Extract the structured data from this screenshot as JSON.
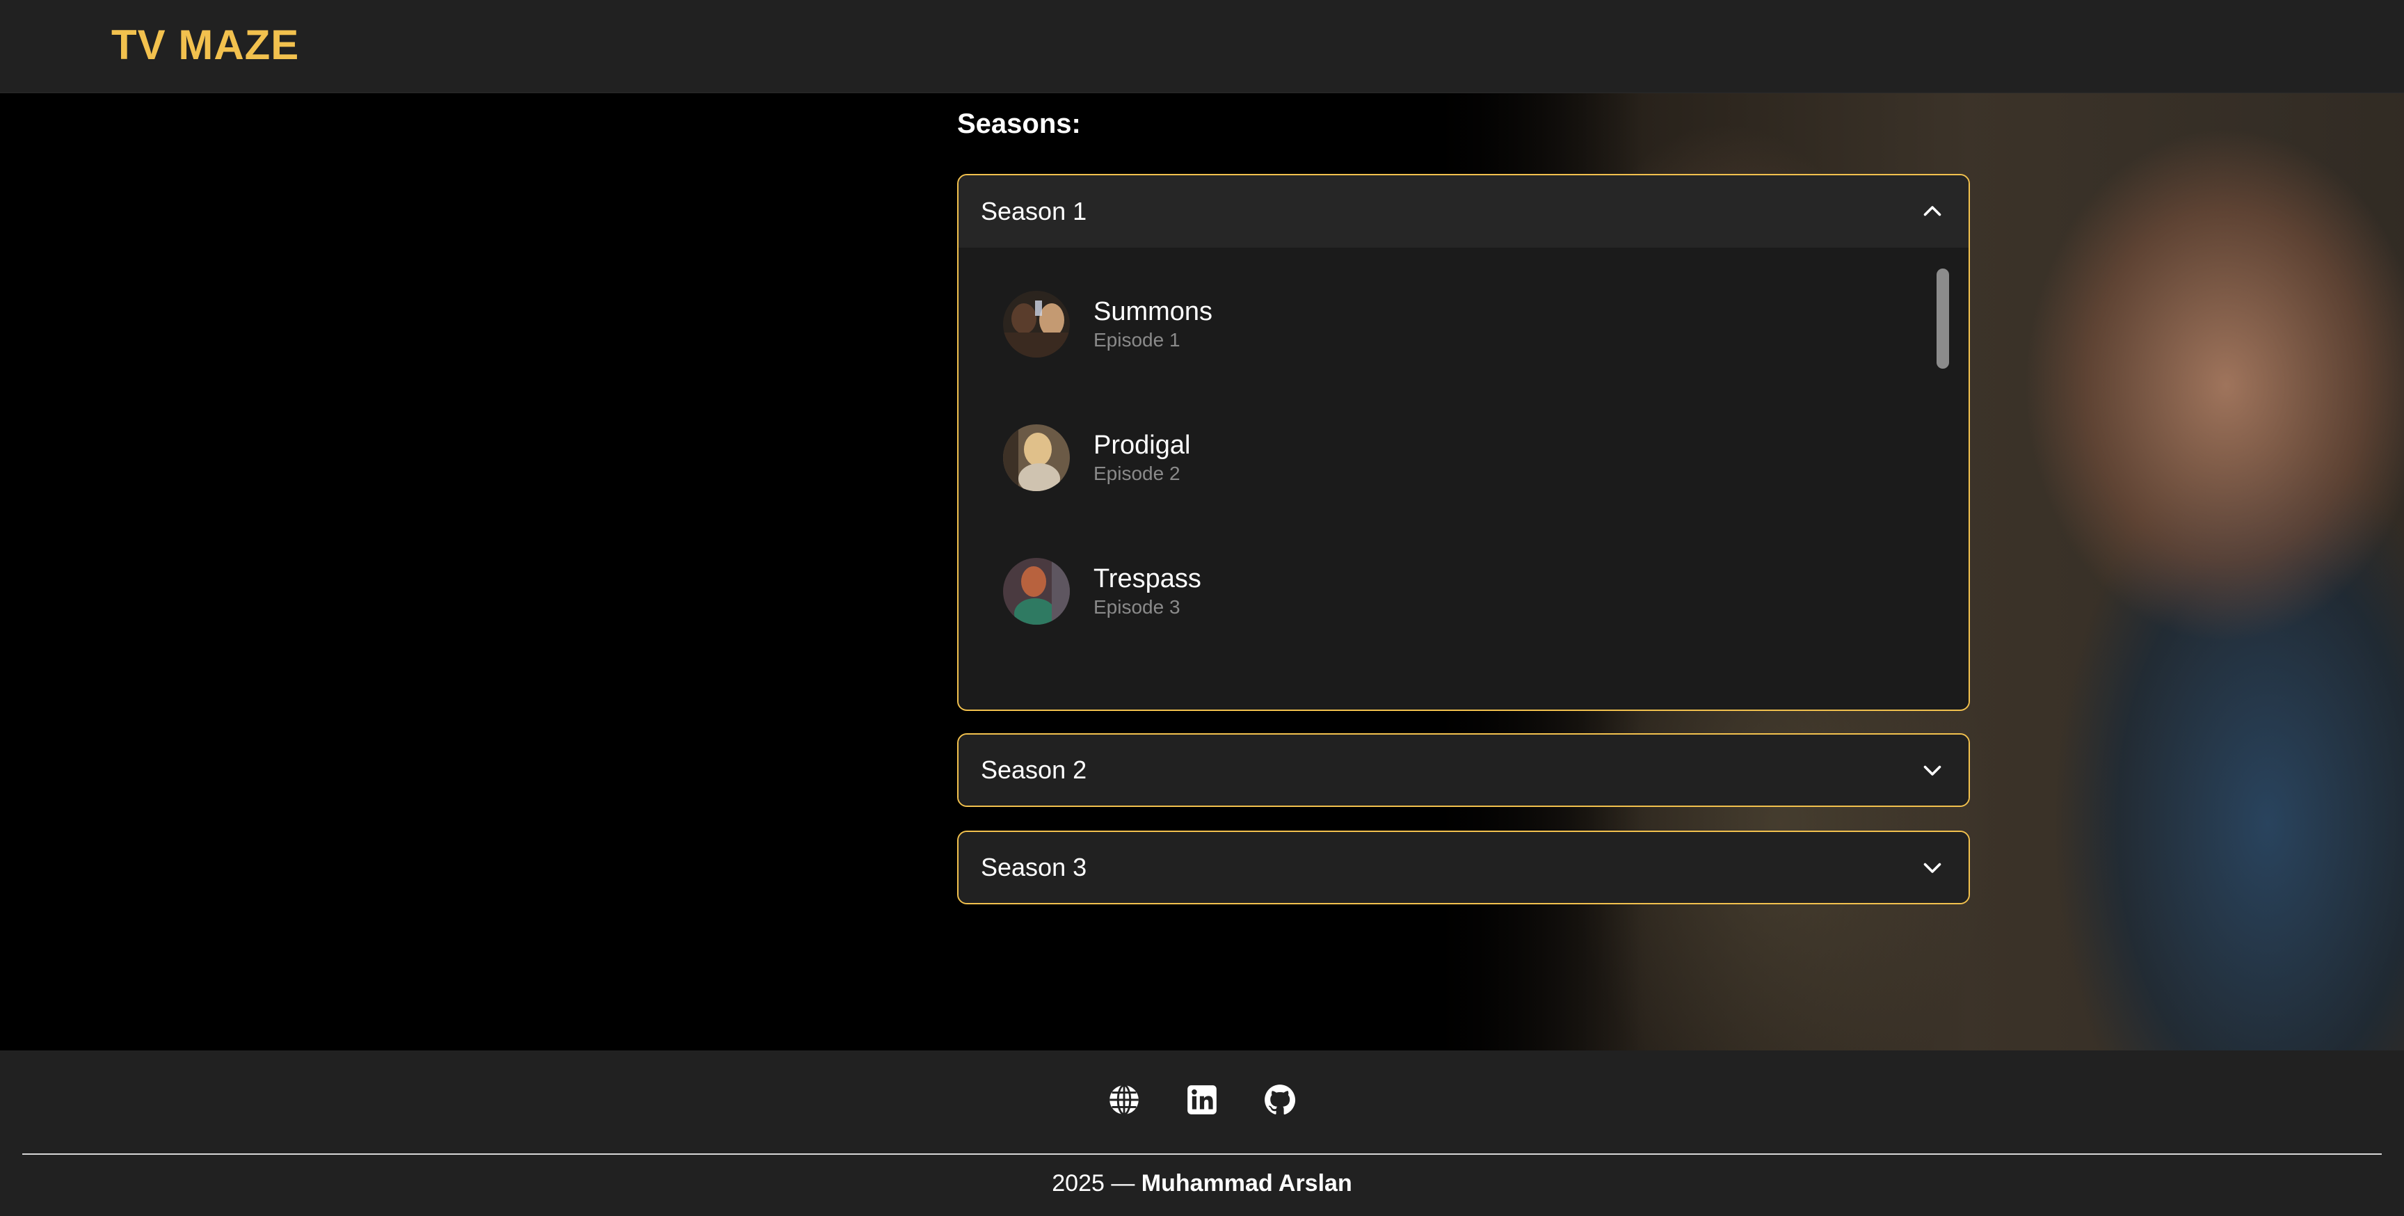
{
  "app": {
    "brand": "TV MAZE"
  },
  "seasons": {
    "title": "Seasons:",
    "list": [
      {
        "label": "Season 1",
        "expanded": true,
        "episodes": [
          {
            "name": "Summons",
            "number": "Episode 1"
          },
          {
            "name": "Prodigal",
            "number": "Episode 2"
          },
          {
            "name": "Trespass",
            "number": "Episode 3"
          }
        ]
      },
      {
        "label": "Season 2",
        "expanded": false
      },
      {
        "label": "Season 3",
        "expanded": false
      }
    ]
  },
  "footer": {
    "icons": [
      "globe-icon",
      "linkedin-icon",
      "github-icon"
    ],
    "year_prefix": "2025 — ",
    "author": "Muhammad Arslan"
  },
  "colors": {
    "accent": "#f2c14e",
    "surface": "#212121",
    "panel": "#1b1b1b",
    "muted_text": "#8a8a8a"
  }
}
